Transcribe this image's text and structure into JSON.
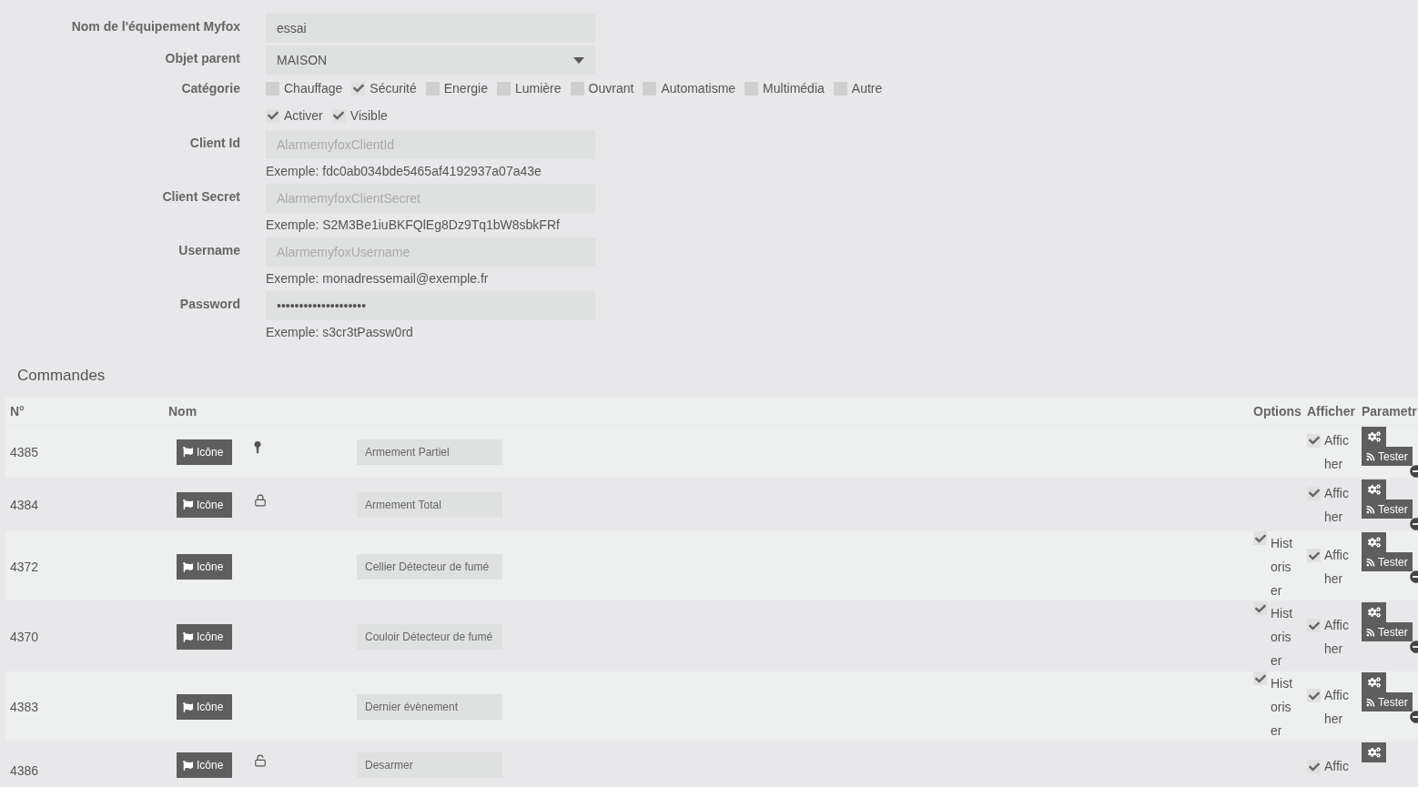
{
  "form": {
    "fields": [
      {
        "kind": "text",
        "label": "Nom de l'équipement Myfox",
        "value": "essai"
      },
      {
        "kind": "select",
        "label": "Objet parent",
        "value": "MAISON"
      },
      {
        "kind": "checkboxes",
        "label": "Catégorie",
        "options": [
          {
            "label": "Chauffage",
            "checked": false
          },
          {
            "label": "Sécurité",
            "checked": true
          },
          {
            "label": "Energie",
            "checked": false
          },
          {
            "label": "Lumière",
            "checked": false
          },
          {
            "label": "Ouvrant",
            "checked": false
          },
          {
            "label": "Automatisme",
            "checked": false
          },
          {
            "label": "Multimédia",
            "checked": false
          },
          {
            "label": "Autre",
            "checked": false
          }
        ]
      },
      {
        "kind": "checkboxes",
        "options": [
          {
            "label": "Activer",
            "checked": true
          },
          {
            "label": "Visible",
            "checked": true
          }
        ]
      },
      {
        "kind": "text",
        "label": "Client Id",
        "placeholder": "AlarmemyfoxClientId",
        "help": "Exemple: fdc0ab034bde5465af4192937a07a43e"
      },
      {
        "kind": "text",
        "label": "Client Secret",
        "placeholder": "AlarmemyfoxClientSecret",
        "help": "Exemple: S2M3Be1iuBKFQlEg8Dz9Tq1bW8sbkFRf"
      },
      {
        "kind": "text",
        "label": "Username",
        "placeholder": "AlarmemyfoxUsername",
        "help": "Exemple: monadressemail@exemple.fr"
      },
      {
        "kind": "text",
        "label": "Password",
        "value": "••••••••••••••••••••",
        "help": "Exemple: s3cr3tPassw0rd"
      }
    ]
  },
  "commands": {
    "title": "Commandes",
    "columns": [
      "N°",
      "Nom",
      "Options",
      "Afficher",
      "Parametr"
    ],
    "rows": [
      {
        "id": "4385",
        "icon_button": "Icône",
        "kind": "key",
        "name": "Armement Partiel",
        "display": {
          "label": "Afficher",
          "checked": true
        },
        "test_button": "Tester"
      },
      {
        "id": "4384",
        "icon_button": "Icône",
        "kind": "lock",
        "name": "Armement Total",
        "display": {
          "label": "Afficher",
          "checked": true
        },
        "test_button": "Tester"
      },
      {
        "id": "4372",
        "icon_button": "Icône",
        "kind": "plain",
        "name": "Cellier Détecteur de fumé",
        "historize": {
          "label": "Historiser",
          "checked": true
        },
        "display": {
          "label": "Afficher",
          "checked": true
        },
        "test_button": "Tester"
      },
      {
        "id": "4370",
        "icon_button": "Icône",
        "kind": "plain",
        "name": "Couloir Détecteur de fumé",
        "historize": {
          "label": "Historiser",
          "checked": true
        },
        "display": {
          "label": "Afficher",
          "checked": true
        },
        "test_button": "Tester"
      },
      {
        "id": "4383",
        "icon_button": "Icône",
        "kind": "plain",
        "name": "Dernier évènement",
        "historize": {
          "label": "Historiser",
          "checked": true
        },
        "display": {
          "label": "Afficher",
          "checked": true
        },
        "test_button": "Tester"
      },
      {
        "id": "4386",
        "icon_button": "Icône",
        "kind": "unlock",
        "name": "Desarmer",
        "display": {
          "label": "Affic",
          "checked": true
        }
      }
    ]
  }
}
